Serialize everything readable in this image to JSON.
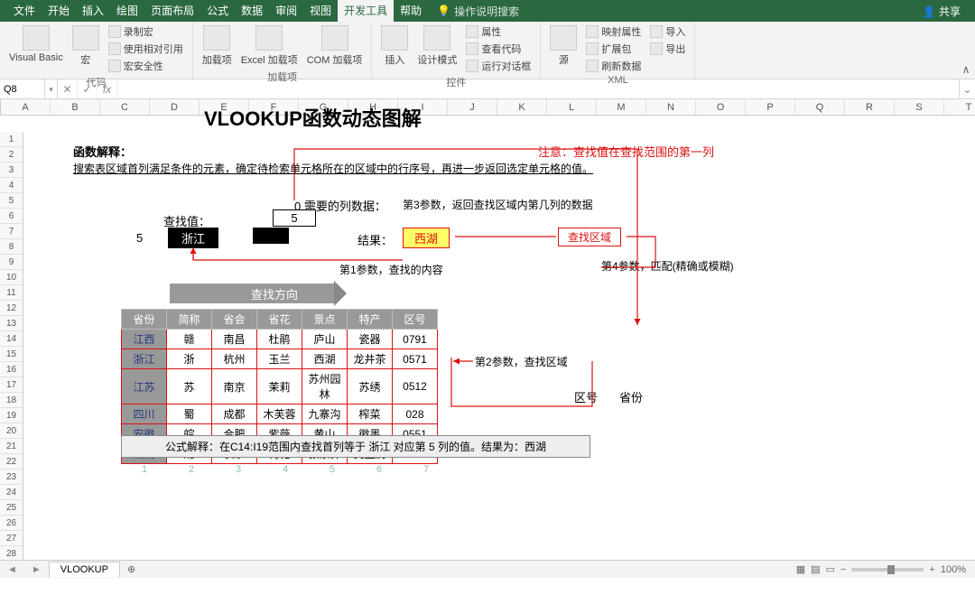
{
  "menubar": {
    "items": [
      "文件",
      "开始",
      "插入",
      "绘图",
      "页面布局",
      "公式",
      "数据",
      "审阅",
      "视图",
      "开发工具",
      "帮助"
    ],
    "active_index": 9,
    "search_hint": "操作说明搜索",
    "share": "共享"
  },
  "ribbon": {
    "groups": [
      {
        "label": "代码",
        "buttons": [
          {
            "t": "Visual Basic",
            "big": true
          },
          {
            "t": "宏",
            "big": true
          }
        ],
        "small": [
          {
            "t": "录制宏"
          },
          {
            "t": "使用相对引用"
          },
          {
            "t": "宏安全性"
          }
        ]
      },
      {
        "label": "加载项",
        "buttons": [
          {
            "t": "加载项",
            "big": true
          },
          {
            "t": "Excel 加载项",
            "big": true
          },
          {
            "t": "COM 加载项",
            "big": true
          }
        ]
      },
      {
        "label": "控件",
        "buttons": [
          {
            "t": "插入",
            "big": true
          },
          {
            "t": "设计模式",
            "big": true
          }
        ],
        "small": [
          {
            "t": "属性"
          },
          {
            "t": "查看代码"
          },
          {
            "t": "运行对话框"
          }
        ]
      },
      {
        "label": "XML",
        "buttons": [
          {
            "t": "源",
            "big": true
          }
        ],
        "small": [
          {
            "t": "映射属性"
          },
          {
            "t": "扩展包"
          },
          {
            "t": "刷新数据"
          }
        ],
        "small2": [
          {
            "t": "导入"
          },
          {
            "t": "导出"
          }
        ]
      }
    ]
  },
  "namebox": "Q8",
  "columns": [
    "A",
    "B",
    "C",
    "D",
    "E",
    "F",
    "G",
    "H",
    "I",
    "J",
    "K",
    "L",
    "M",
    "N",
    "O",
    "P",
    "Q",
    "R",
    "S",
    "T"
  ],
  "row_count": 30,
  "content": {
    "title": "VLOOKUP函数动态图解",
    "explain_label": "函数解释：",
    "explain_text": "搜索表区域首列满足条件的元素，确定待检索单元格所在的区域中的行序号，再进一步返回选定单元格的值。",
    "warning": "注意：查找值在查找范围的第一列",
    "col_needed_label": "0 需要的列数据：",
    "param3": "第3参数，返回查找区域内第几列的数据",
    "lookup_label": "查找值：",
    "lookup_num": "5",
    "col_box": "5",
    "province": "浙江",
    "result_label": "结果：",
    "result_value": "西湖",
    "search_area": "查找区域",
    "param4": "第4参数，匹配(精确或模糊)",
    "param1": "第1参数，查找的内容",
    "arrow_label": "查找方向",
    "param2": "第2参数，查找区域",
    "extra1": "区号",
    "extra2": "省份",
    "colnums": [
      "1",
      "2",
      "3",
      "4",
      "5",
      "6",
      "7"
    ],
    "formula_explain": "公式解释：在C14:I19范围内查找首列等于 浙江 对应第 5 列的值。结果为：西湖"
  },
  "table": {
    "headers": [
      "省份",
      "简称",
      "省会",
      "省花",
      "景点",
      "特产",
      "区号"
    ],
    "rows": [
      [
        "江西",
        "赣",
        "南昌",
        "杜鹃",
        "庐山",
        "瓷器",
        "0791"
      ],
      [
        "浙江",
        "浙",
        "杭州",
        "玉兰",
        "西湖",
        "龙井茶",
        "0571"
      ],
      [
        "江苏",
        "苏",
        "南京",
        "茉莉",
        "苏州园林",
        "苏绣",
        "0512"
      ],
      [
        "四川",
        "蜀",
        "成都",
        "木芙蓉",
        "九寨沟",
        "榨菜",
        "028"
      ],
      [
        "安徽",
        "皖",
        "合肥",
        "紫薇",
        "黄山",
        "徽墨",
        "0551"
      ],
      [
        "湖南",
        "湘",
        "长沙",
        "荷花",
        "张家界",
        "臭豆腐",
        "0731"
      ]
    ]
  },
  "sheet": {
    "tabs": [
      "VLOOKUP"
    ],
    "zoom": "100%"
  }
}
